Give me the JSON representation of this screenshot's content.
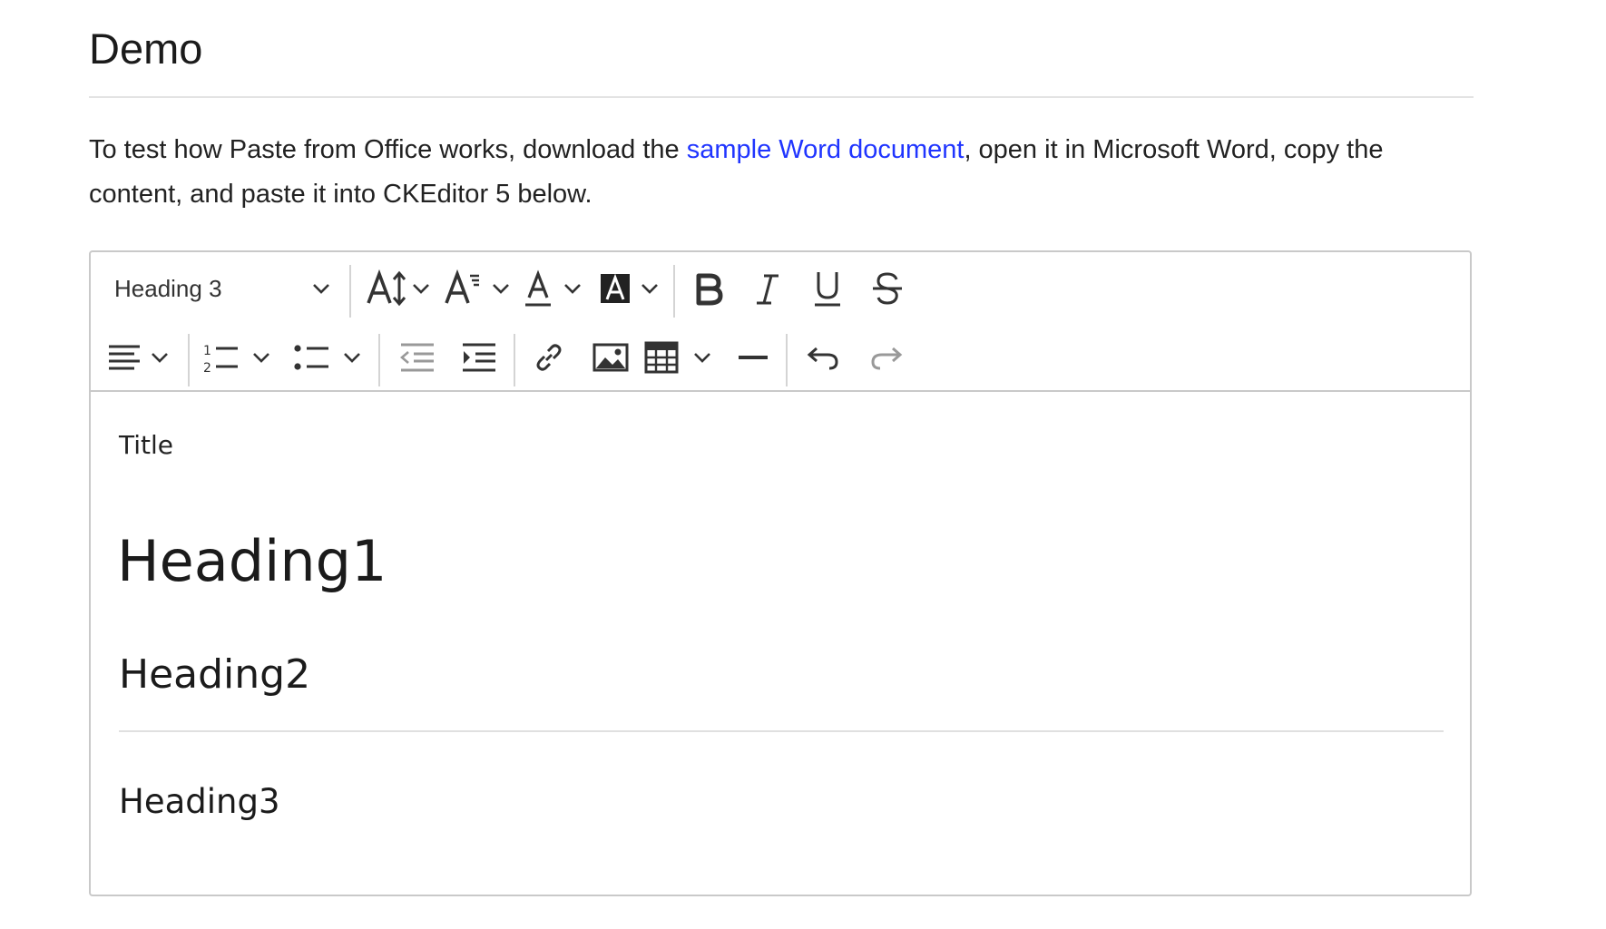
{
  "page": {
    "title": "Demo",
    "intro_before": "To test how Paste from Office works, download the ",
    "intro_link": "sample Word document",
    "intro_after": ", open it in Microsoft Word, copy the content, and paste it into CKEditor 5 below."
  },
  "toolbar": {
    "heading_dropdown": "Heading 3",
    "row1_buttons": [
      "font-size",
      "font-family",
      "font-color",
      "font-background-color",
      "bold",
      "italic",
      "underline",
      "strikethrough"
    ],
    "row2_buttons": [
      "alignment",
      "numbered-list",
      "bulleted-list",
      "outdent",
      "indent",
      "link",
      "image",
      "table",
      "horizontal-line",
      "undo",
      "redo"
    ]
  },
  "content": {
    "title": "Title",
    "heading1": "Heading1",
    "heading2": "Heading2",
    "heading3": "Heading3"
  }
}
